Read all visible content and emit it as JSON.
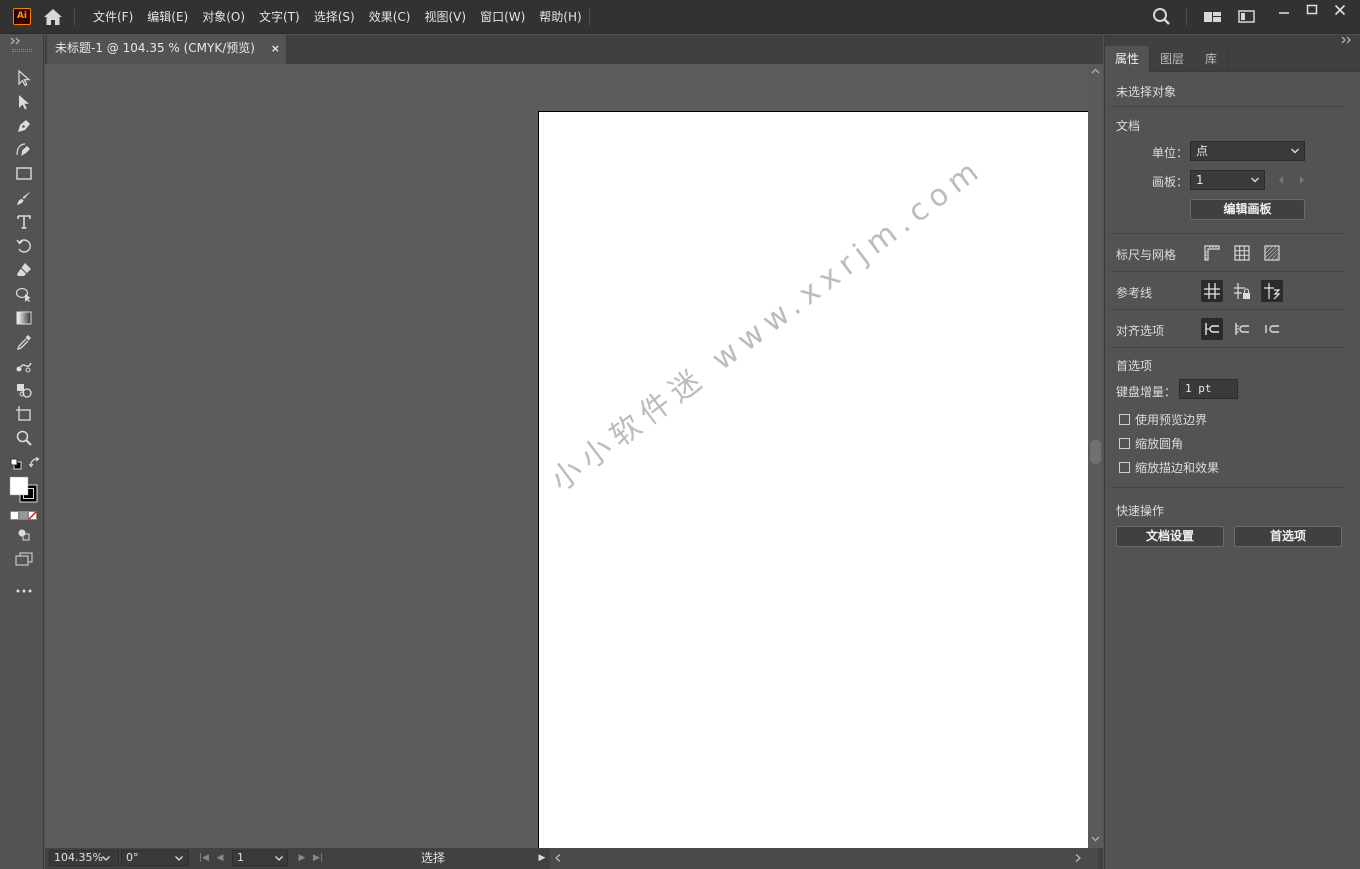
{
  "app": {
    "logo_text": "Ai"
  },
  "menu": [
    "文件(F)",
    "编辑(E)",
    "对象(O)",
    "文字(T)",
    "选择(S)",
    "效果(C)",
    "视图(V)",
    "窗口(W)",
    "帮助(H)"
  ],
  "document_tab": {
    "title": "未标题-1 @ 104.35 % (CMYK/预览)",
    "close": "×"
  },
  "watermark": "小小软件迷 www.xxrjm.com",
  "status_bar": {
    "zoom": "104.35%",
    "rotation": "0°",
    "artboard_number": "1",
    "tool_status": "选择"
  },
  "panel": {
    "tabs": [
      "属性",
      "图层",
      "库"
    ],
    "selection_status": "未选择对象",
    "document": {
      "title": "文档",
      "unit_label": "单位：",
      "unit_value": "点",
      "artboard_label": "画板：",
      "artboard_value": "1",
      "edit_artboard_button": "编辑画板"
    },
    "rulers_grids": {
      "title": "标尺与网格"
    },
    "guides": {
      "title": "参考线"
    },
    "snap_options": {
      "title": "对齐选项"
    },
    "preferences": {
      "title": "首选项",
      "keyboard_increment_label": "键盘增量：",
      "keyboard_increment_value": "1 pt",
      "checkboxes": [
        "使用预览边界",
        "缩放圆角",
        "缩放描边和效果"
      ]
    },
    "quick_actions": {
      "title": "快速操作",
      "document_setup_button": "文档设置",
      "preferences_button": "首选项"
    }
  }
}
